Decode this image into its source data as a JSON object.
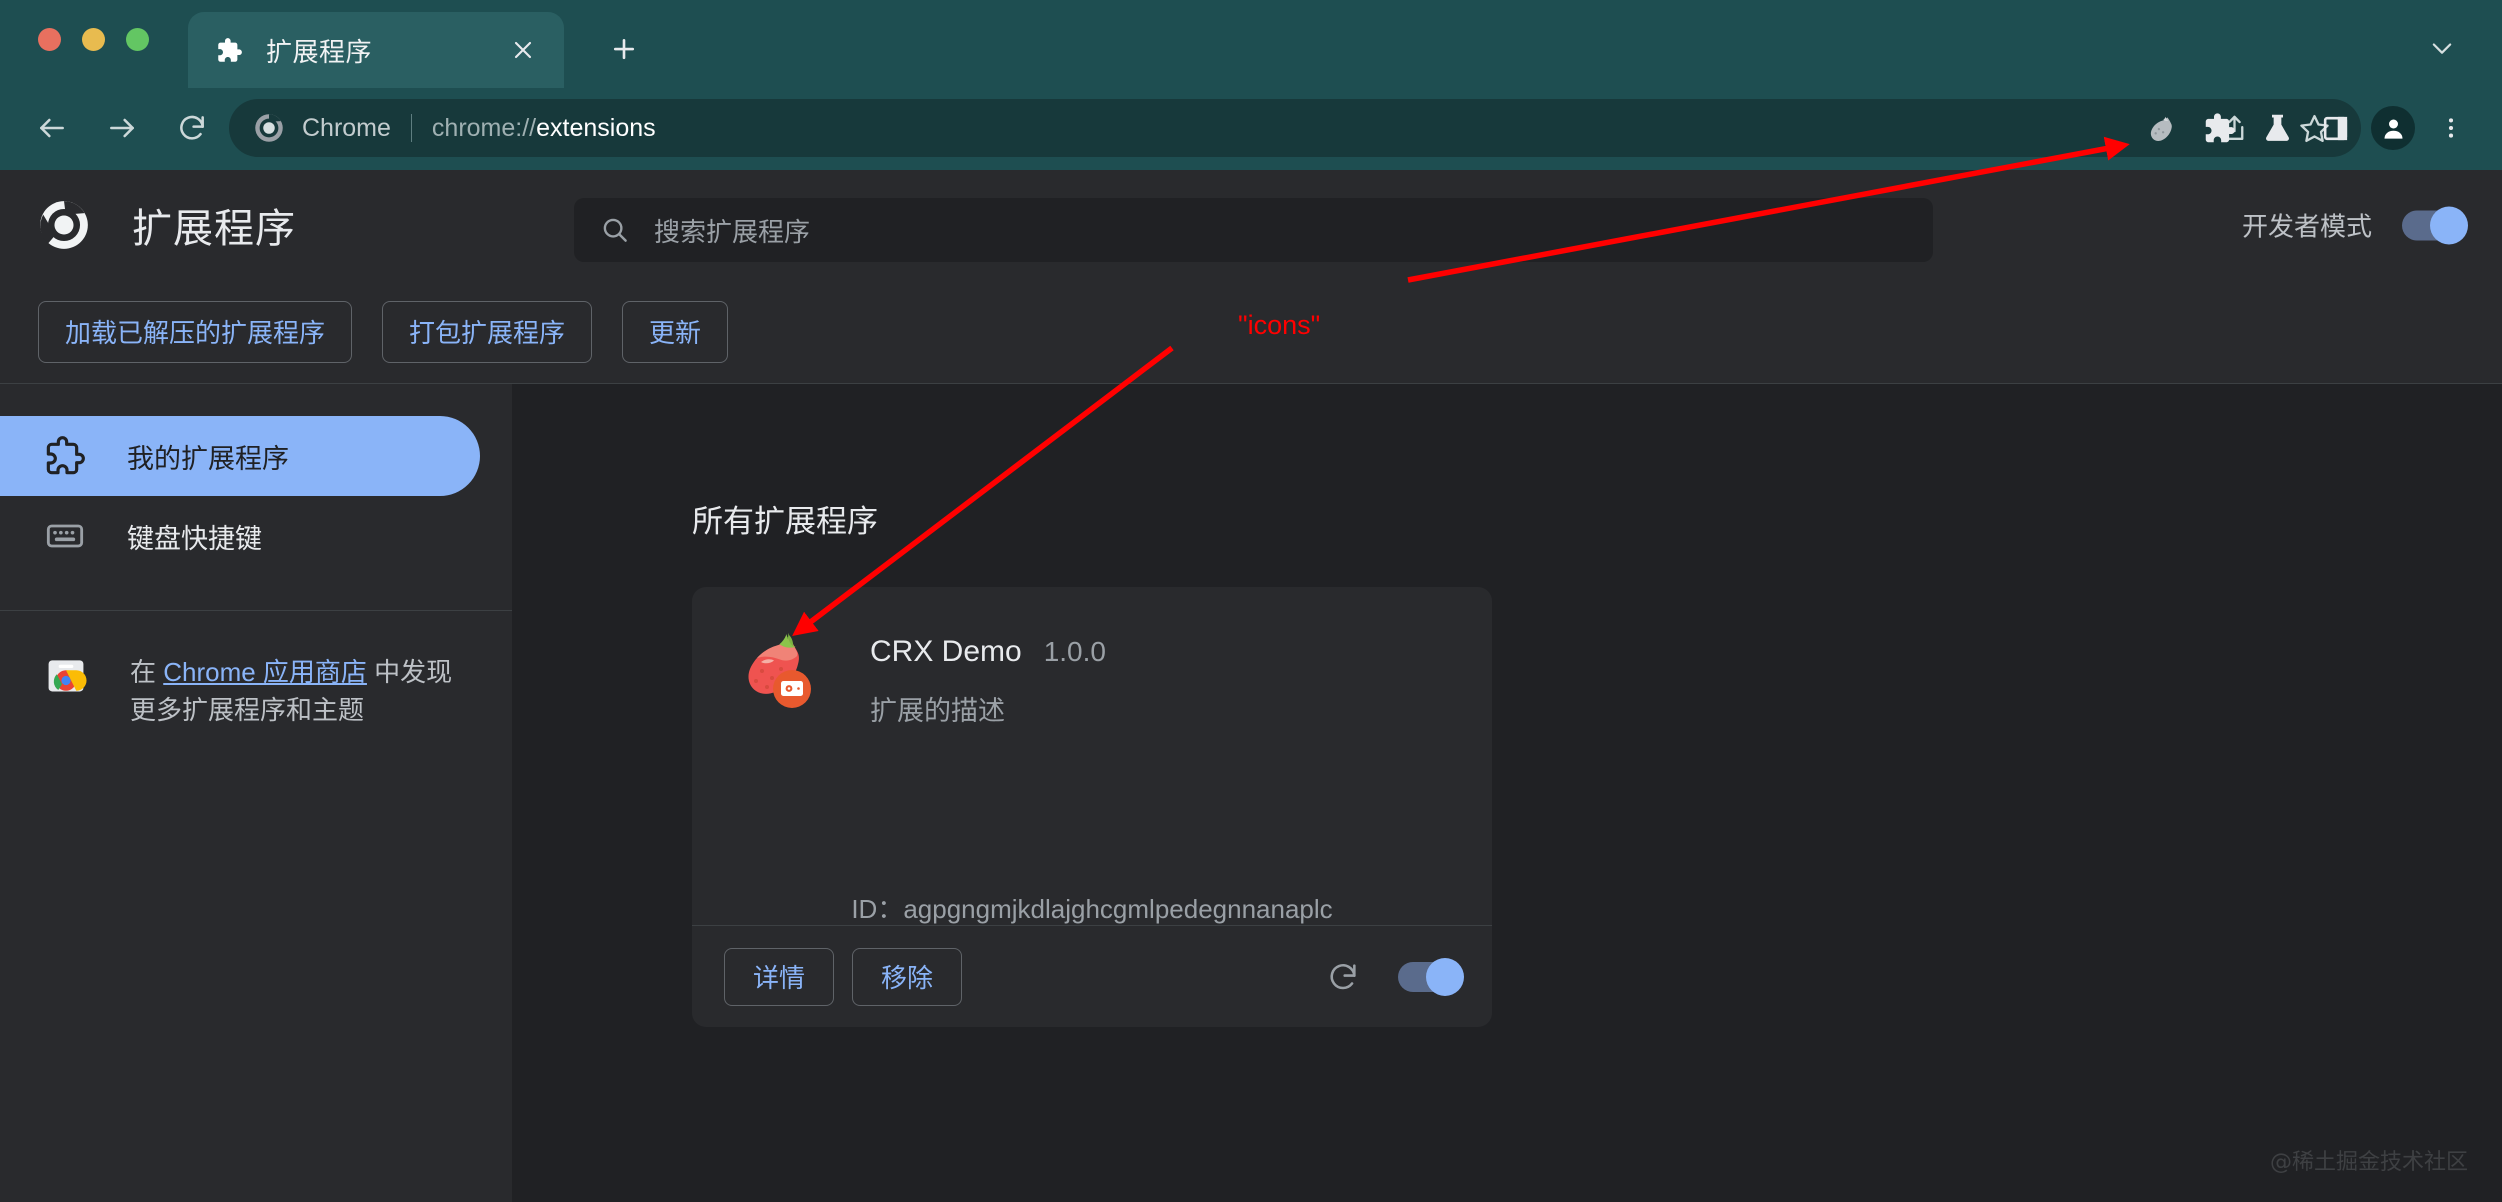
{
  "window": {
    "traffic_lights": [
      "close",
      "minimize",
      "maximize"
    ],
    "tab": {
      "title": "扩展程序",
      "favicon": "puzzle-piece-icon",
      "close_label": "×"
    },
    "new_tab_label": "+",
    "tabstrip_chevron": "chevron-down-icon"
  },
  "toolbar": {
    "back": "back-arrow-icon",
    "forward": "forward-arrow-icon",
    "reload": "reload-icon",
    "omnibox": {
      "chip_label": "Chrome",
      "url_scheme": "chrome://",
      "url_path": "extensions",
      "share_icon": "share-icon",
      "bookmark_icon": "star-icon"
    },
    "right_icons": [
      "strawberry-extension-icon",
      "puzzle-extensions-icon",
      "lab-flask-icon",
      "side-panel-icon",
      "profile-avatar-icon",
      "three-dot-menu-icon"
    ]
  },
  "ext_header": {
    "logo": "chrome-logo-icon",
    "title": "扩展程序",
    "search": {
      "icon": "search-icon",
      "placeholder": "搜索扩展程序",
      "value": ""
    },
    "dev_mode": {
      "label": "开发者模式",
      "enabled": true
    }
  },
  "actions": {
    "load_unpacked": "加载已解压的扩展程序",
    "pack_extension": "打包扩展程序",
    "update": "更新"
  },
  "sidebar": {
    "items": [
      {
        "label": "我的扩展程序",
        "icon": "puzzle-piece-icon",
        "active": true
      },
      {
        "label": "键盘快捷键",
        "icon": "keyboard-icon",
        "active": false
      }
    ],
    "store_prefix": "在 ",
    "store_link": "Chrome 应用商店",
    "store_suffix": " 中发现",
    "store_line2": "更多扩展程序和主题",
    "store_icon": "chrome-web-store-icon"
  },
  "main": {
    "section_title": "所有扩展程序",
    "extension": {
      "icon": "strawberry-icon",
      "badge_icon": "orange-badge-icon",
      "name": "CRX Demo",
      "version": "1.0.0",
      "description": "扩展的描述",
      "id_label": "ID：",
      "id_value": "agpgngmjkdlajghcgmlpedegnnanaplc",
      "details_button": "详情",
      "remove_button": "移除",
      "reload_icon": "reload-icon",
      "enabled": true
    }
  },
  "annotations": {
    "icons_label": "\"icons\"",
    "color": "#ff0000"
  },
  "watermark": "@稀土掘金技术社区",
  "colors": {
    "frame": "#1e4e51",
    "tab_active": "#2a5f62",
    "omnibox": "#17393b",
    "page_bg": "#202124",
    "surface": "#292a2d",
    "accent_blue": "#8ab4f8",
    "text_primary": "#e8eaed",
    "text_secondary": "#9aa0a6",
    "annotation_red": "#ff0000"
  }
}
